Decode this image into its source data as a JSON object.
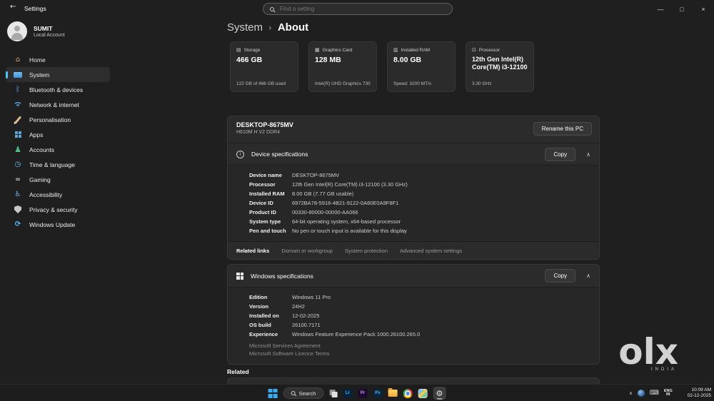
{
  "titlebar": {
    "app_title": "Settings",
    "search_placeholder": "Find a setting",
    "controls": {
      "minimize": "—",
      "maximize": "□",
      "close": "×"
    }
  },
  "sidebar": {
    "user": {
      "name": "SUMIT",
      "subtitle": "Local Account"
    },
    "items": [
      {
        "label": "Home",
        "icon": "home-icon"
      },
      {
        "label": "System",
        "icon": "system-icon"
      },
      {
        "label": "Bluetooth & devices",
        "icon": "bluetooth-icon"
      },
      {
        "label": "Network & internet",
        "icon": "network-icon"
      },
      {
        "label": "Personalisation",
        "icon": "personalisation-icon"
      },
      {
        "label": "Apps",
        "icon": "apps-icon"
      },
      {
        "label": "Accounts",
        "icon": "accounts-icon"
      },
      {
        "label": "Time & language",
        "icon": "time-language-icon"
      },
      {
        "label": "Gaming",
        "icon": "gaming-icon"
      },
      {
        "label": "Accessibility",
        "icon": "accessibility-icon"
      },
      {
        "label": "Privacy & security",
        "icon": "privacy-security-icon"
      },
      {
        "label": "Windows Update",
        "icon": "windows-update-icon"
      }
    ]
  },
  "main": {
    "breadcrumb": {
      "parent": "System",
      "current": "About"
    },
    "cards": [
      {
        "label": "Storage",
        "value": "466 GB",
        "caption": "122 GB of 466 GB used"
      },
      {
        "label": "Graphics Card",
        "value": "128 MB",
        "caption": "Intel(R) UHD Graphics 730"
      },
      {
        "label": "Installed RAM",
        "value": "8.00 GB",
        "caption": "Speed: 3200 MT/s"
      },
      {
        "label": "Processor",
        "value": "12th Gen Intel(R) Core(TM) i3-12100",
        "caption": "3.30 GHz"
      }
    ],
    "device": {
      "name": "DESKTOP-8675MV",
      "subtitle": "H610M H V2 DDR4",
      "rename_button": "Rename this PC"
    },
    "device_specs": {
      "title": "Device specifications",
      "copy_button": "Copy",
      "rows": [
        {
          "label": "Device name",
          "value": "DESKTOP-8675MV"
        },
        {
          "label": "Processor",
          "value": "12th Gen Intel(R) Core(TM) i3-12100 (3.30 GHz)"
        },
        {
          "label": "Installed RAM",
          "value": "8.00 GB (7.77 GB usable)"
        },
        {
          "label": "Device ID",
          "value": "6972BA78-5916-4B21-9122-0A60E0A9F8F1"
        },
        {
          "label": "Product ID",
          "value": "00330-80000-00000-AA066"
        },
        {
          "label": "System type",
          "value": "64-bit operating system, x64-based processor"
        },
        {
          "label": "Pen and touch",
          "value": "No pen or touch input is available for this display"
        }
      ]
    },
    "related_links": {
      "label": "Related links",
      "links": [
        "Domain or workgroup",
        "System protection",
        "Advanced system settings"
      ]
    },
    "windows_specs": {
      "title": "Windows specifications",
      "copy_button": "Copy",
      "rows": [
        {
          "label": "Edition",
          "value": "Windows 11 Pro"
        },
        {
          "label": "Version",
          "value": "24H2"
        },
        {
          "label": "Installed on",
          "value": "12-02-2025"
        },
        {
          "label": "OS build",
          "value": "26100.7171"
        },
        {
          "label": "Experience",
          "value": "Windows Feature Experience Pack 1000.26100.265.0"
        }
      ],
      "links": [
        "Microsoft Services Agreement",
        "Microsoft Software Licence Terms"
      ]
    },
    "related_heading": "Related"
  },
  "watermark": {
    "logo": "olx",
    "sub": "INDIA"
  },
  "taskbar": {
    "search_label": "Search",
    "adobe": {
      "lr": "Lr",
      "pr": "Pr",
      "ps": "Ps"
    },
    "tray": {
      "lang_top": "ENG",
      "lang_bottom": "IN",
      "time": "10:09 AM",
      "date": "02-12-2025"
    }
  },
  "colors": {
    "accent": "#4cc2ff",
    "card_bg": "#2b2b2b",
    "window_bg": "#1f1f1f"
  }
}
